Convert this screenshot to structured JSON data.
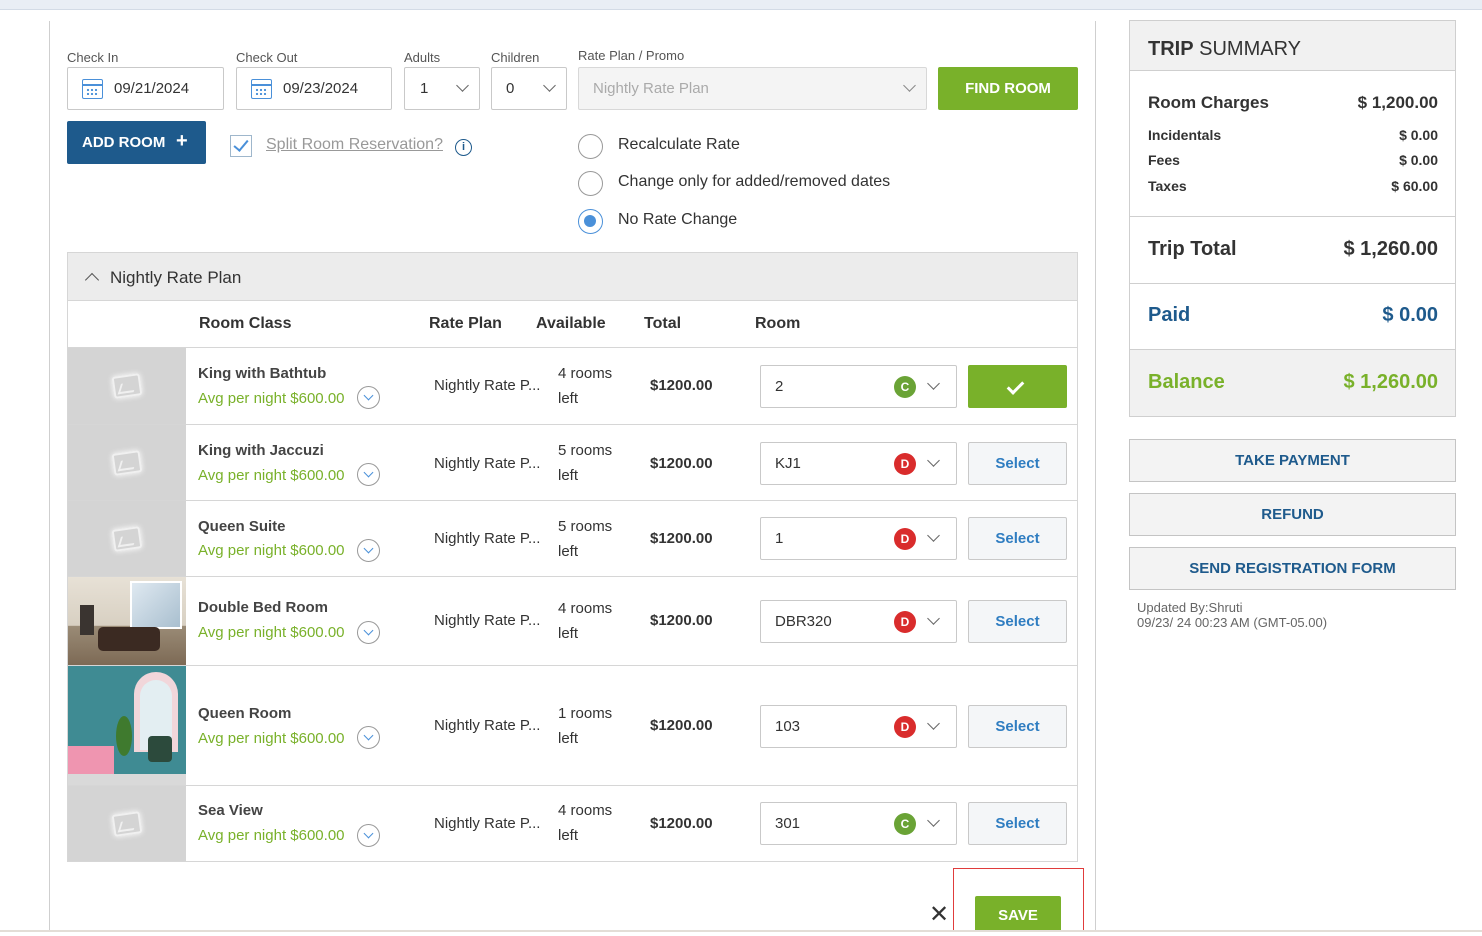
{
  "form": {
    "check_in_label": "Check In",
    "check_in_value": "09/21/2024",
    "check_out_label": "Check Out",
    "check_out_value": "09/23/2024",
    "adults_label": "Adults",
    "adults_value": "1",
    "children_label": "Children",
    "children_value": "0",
    "rate_plan_label": "Rate Plan / Promo",
    "rate_plan_placeholder": "Nightly Rate Plan",
    "find_room_label": "FIND ROOM",
    "add_room_label": "ADD ROOM",
    "add_room_plus": "+",
    "split_label": "Split Room Reservation?",
    "info_glyph": "i",
    "split_checked": true
  },
  "rate_options": [
    {
      "label": "Recalculate Rate",
      "selected": false
    },
    {
      "label": "Change only for added/removed dates",
      "selected": false
    },
    {
      "label": "No Rate Change",
      "selected": true
    }
  ],
  "rate_plan_section": {
    "title": "Nightly Rate Plan",
    "expanded": true
  },
  "table": {
    "headers": {
      "room_class": "Room Class",
      "rate_plan": "Rate Plan",
      "available": "Available",
      "total": "Total",
      "room": "Room"
    },
    "rows": [
      {
        "name": "King with Bathtub",
        "avg": "Avg per night $600.00",
        "plan": "Nightly Rate P...",
        "avail_1": "4 rooms",
        "avail_2": "left",
        "total": "$1200.00",
        "room": "2",
        "badge": "C",
        "action": "",
        "selected": true,
        "image": "placeholder"
      },
      {
        "name": "King with Jaccuzi",
        "avg": "Avg per night $600.00",
        "plan": "Nightly Rate P...",
        "avail_1": "5 rooms",
        "avail_2": "left",
        "total": "$1200.00",
        "room": "KJ1",
        "badge": "D",
        "action": "Select",
        "selected": false,
        "image": "placeholder"
      },
      {
        "name": "Queen Suite",
        "avg": "Avg per night $600.00",
        "plan": "Nightly Rate P...",
        "avail_1": "5 rooms",
        "avail_2": "left",
        "total": "$1200.00",
        "room": "1",
        "badge": "D",
        "action": "Select",
        "selected": false,
        "image": "placeholder"
      },
      {
        "name": "Double Bed Room",
        "avg": "Avg per night $600.00",
        "plan": "Nightly Rate P...",
        "avail_1": "4 rooms",
        "avail_2": "left",
        "total": "$1200.00",
        "room": "DBR320",
        "badge": "D",
        "action": "Select",
        "selected": false,
        "image": "photo-living-room"
      },
      {
        "name": "Queen Room",
        "avg": "Avg per night $600.00",
        "plan": "Nightly Rate P...",
        "avail_1": "1 rooms",
        "avail_2": "left",
        "total": "$1200.00",
        "room": "103",
        "badge": "D",
        "action": "Select",
        "selected": false,
        "image": "photo-teal-room"
      },
      {
        "name": "Sea View",
        "avg": "Avg per night $600.00",
        "plan": "Nightly Rate P...",
        "avail_1": "4 rooms",
        "avail_2": "left",
        "total": "$1200.00",
        "room": "301",
        "badge": "C",
        "action": "Select",
        "selected": false,
        "image": "placeholder"
      }
    ]
  },
  "footer": {
    "close_glyph": "✕",
    "save_label": "SAVE"
  },
  "summary": {
    "title_bold": "TRIP",
    "title_rest": " SUMMARY",
    "room_charges_label": "Room Charges",
    "room_charges_value": "$ 1,200.00",
    "incidentals_label": "Incidentals",
    "incidentals_value": "$ 0.00",
    "fees_label": "Fees",
    "fees_value": "$ 0.00",
    "taxes_label": "Taxes",
    "taxes_value": "$ 60.00",
    "trip_total_label": "Trip Total",
    "trip_total_value": "$ 1,260.00",
    "paid_label": "Paid",
    "paid_value": "$ 0.00",
    "balance_label": "Balance",
    "balance_value": "$ 1,260.00"
  },
  "actions": {
    "take_payment": "TAKE PAYMENT",
    "refund": "REFUND",
    "send_registration": "SEND REGISTRATION FORM"
  },
  "updated": {
    "by": "Updated By:Shruti",
    "at": "09/23/ 24 00:23 AM (GMT-05.00)"
  },
  "colors": {
    "accent_green": "#79b12a",
    "brand_blue": "#1e5a8c",
    "link_blue": "#2f7dc1",
    "badge_c": "#6aa336",
    "badge_d": "#d92c2c"
  }
}
